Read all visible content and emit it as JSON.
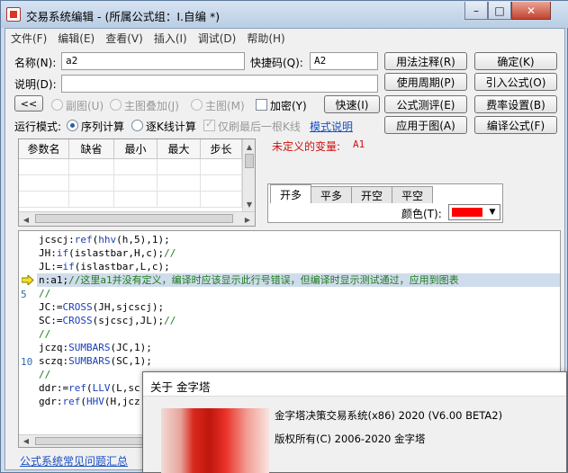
{
  "window": {
    "title": "交易系统编辑 - (所属公式组：I.自编 *)",
    "min_glyph": "–",
    "max_glyph": "□",
    "close_glyph": "✕"
  },
  "menu": [
    "文件(F)",
    "编辑(E)",
    "查看(V)",
    "插入(I)",
    "调试(D)",
    "帮助(H)"
  ],
  "form": {
    "name_label": "名称(N):",
    "name_value": "a2",
    "shortcut_label": "快捷码(Q):",
    "shortcut_value": "A2",
    "desc_label": "说明(D):",
    "desc_value": "",
    "collapse_label": "<<",
    "radio_sub": "副图(U)",
    "radio_overlay": "主图叠加(J)",
    "radio_main": "主图(M)",
    "encrypt_label": "加密(Y)",
    "quick_label": "快速(I)",
    "run_mode_label": "运行模式:",
    "run_seq": "序列计算",
    "run_bar": "逐K线计算",
    "last_bar_only": "仅刷最后一根K线",
    "mode_help": "模式说明",
    "undefined_var_label": "未定义的变量:",
    "undefined_var_value": "A1"
  },
  "buttons": {
    "usage_note": "用法注释(R)",
    "confirm": "确定(K)",
    "use_period": "使用周期(P)",
    "import_formula": "引入公式(O)",
    "formula_test": "公式测评(E)",
    "fee_settings": "费率设置(B)",
    "apply_chart": "应用于图(A)",
    "compile": "编译公式(F)"
  },
  "params": {
    "headers": [
      "参数名",
      "缺省",
      "最小",
      "最大",
      "步长"
    ],
    "rows": 4
  },
  "signals": {
    "tabs": [
      "开多",
      "平多",
      "开空",
      "平空"
    ],
    "active_tab": 0,
    "color_label": "颜色(T):",
    "color_value": "#ff0000"
  },
  "code": {
    "lines": [
      "jcscj:ref(hhv(h,5),1);",
      "JH:if(islastbar,H,c);//",
      "JL:=if(islastbar,L,c);",
      "n:a1;//这里a1并没有定义，编译时应该显示此行号错误，但编译时显示测试通过，应用到图表",
      "//",
      "JC:=CROSS(JH,sjcscj);",
      "SC:=CROSS(sjcscj,JL);//",
      "//",
      "jczq:SUMBARS(JC,1);",
      "sczq:SUMBARS(SC,1);",
      "//",
      "ddr:=ref(LLV(L,sc",
      "gdr:ref(HHV(H,jcz"
    ],
    "line_numbers": [
      "5",
      "10"
    ],
    "current_line": 4
  },
  "footer_link": "公式系统常见问题汇总",
  "about": {
    "title": "关于 金字塔",
    "product": "金字塔决策交易系统(x86) 2020 (V6.00 BETA2)",
    "copyright": "版权所有(C) 2006-2020 金字塔"
  }
}
